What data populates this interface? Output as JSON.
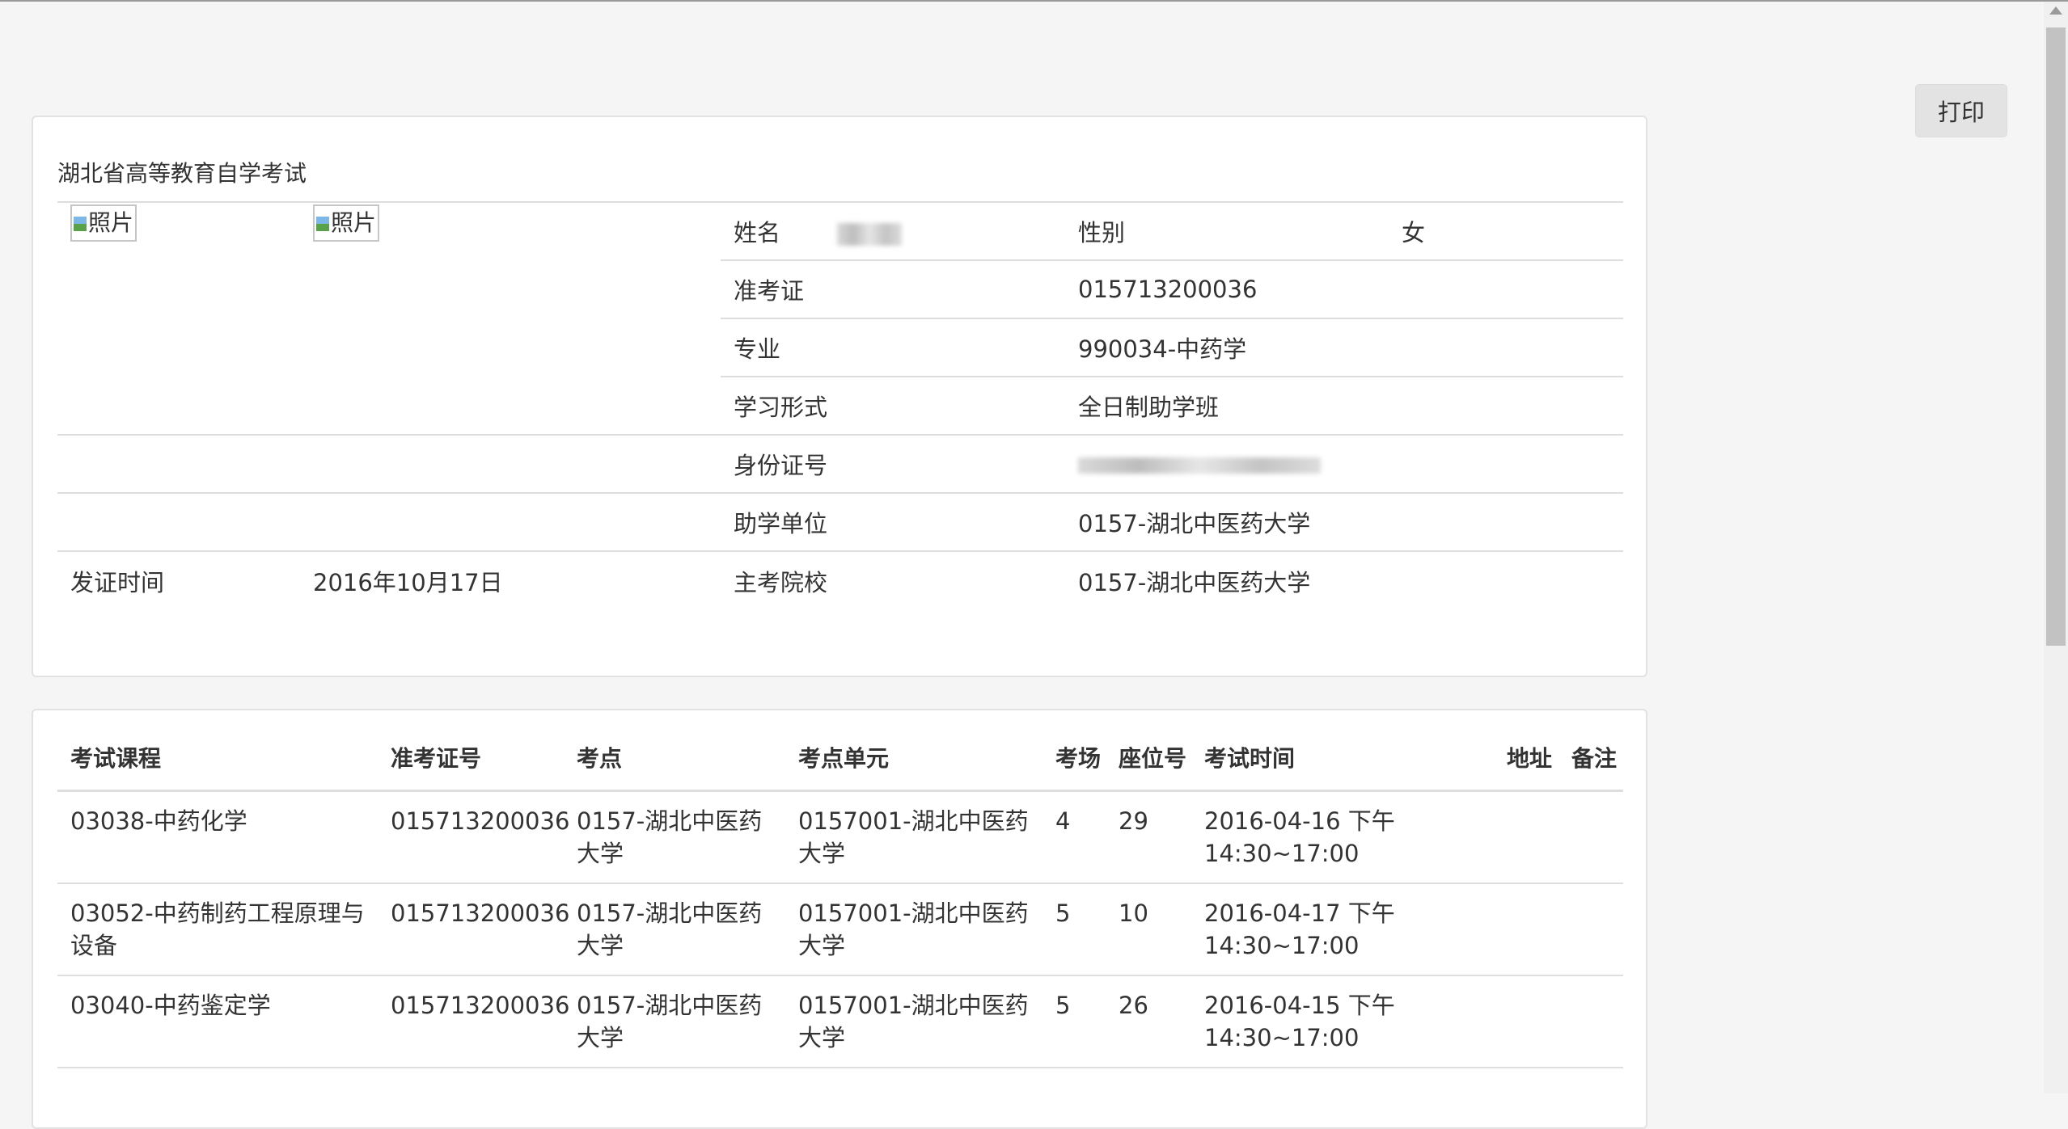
{
  "print_button": "打印",
  "panel_title": "湖北省高等教育自学考试",
  "photo_alt": "照片",
  "info": {
    "name_label": "姓名",
    "name_value": "",
    "gender_label": "性别",
    "gender_value": "女",
    "ticket_label": "准考证",
    "ticket_value": "015713200036",
    "major_label": "专业",
    "major_value": "990034-中药学",
    "study_form_label": "学习形式",
    "study_form_value": "全日制助学班",
    "id_label": "身份证号",
    "id_value": "",
    "assist_unit_label": "助学单位",
    "assist_unit_value": "0157-湖北中医药大学",
    "issue_label": "发证时间",
    "issue_value": "2016年10月17日",
    "school_label": "主考院校",
    "school_value": "0157-湖北中医药大学"
  },
  "exam_table": {
    "headers": {
      "course": "考试课程",
      "ticket": "准考证号",
      "site": "考点",
      "unit": "考点单元",
      "room": "考场",
      "seat": "座位号",
      "time": "考试时间",
      "address": "地址",
      "note": "备注"
    },
    "rows": [
      {
        "course": "03038-中药化学",
        "ticket": "015713200036",
        "site": "0157-湖北中医药大学",
        "unit": "0157001-湖北中医药大学",
        "room": "4",
        "seat": "29",
        "time": "2016-04-16 下午 14:30~17:00",
        "address": "",
        "note": ""
      },
      {
        "course": "03052-中药制药工程原理与设备",
        "ticket": "015713200036",
        "site": "0157-湖北中医药大学",
        "unit": "0157001-湖北中医药大学",
        "room": "5",
        "seat": "10",
        "time": "2016-04-17 下午 14:30~17:00",
        "address": "",
        "note": ""
      },
      {
        "course": "03040-中药鉴定学",
        "ticket": "015713200036",
        "site": "0157-湖北中医药大学",
        "unit": "0157001-湖北中医药大学",
        "room": "5",
        "seat": "26",
        "time": "2016-04-15 下午 14:30~17:00",
        "address": "",
        "note": ""
      }
    ]
  }
}
